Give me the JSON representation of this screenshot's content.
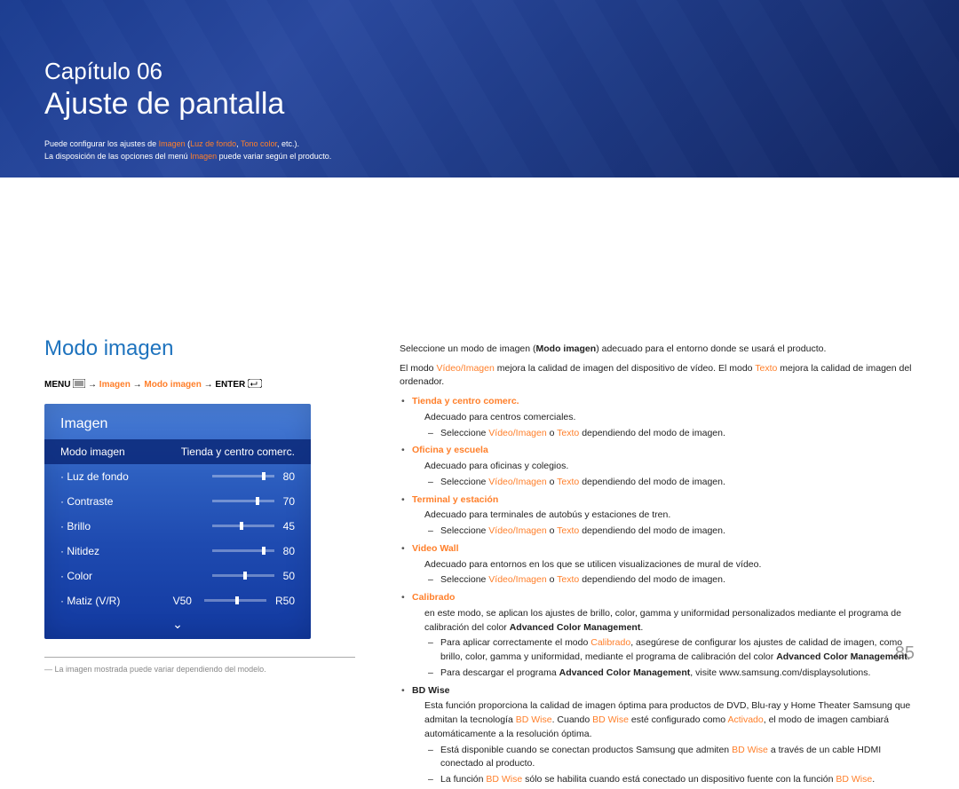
{
  "chapter": "Capítulo 06",
  "title": "Ajuste de pantalla",
  "intro": {
    "line1_pre": "Puede configurar los ajustes de ",
    "line1_a1": "Imagen",
    "line1_mid1": " (",
    "line1_a2": "Luz de fondo",
    "line1_mid2": ", ",
    "line1_a3": "Tono color",
    "line1_post": ", etc.).",
    "line2_pre": "La disposición de las opciones del menú ",
    "line2_a": "Imagen",
    "line2_post": " puede variar según el producto."
  },
  "section_title": "Modo imagen",
  "menu_path": {
    "menu": "MENU",
    "arrow": " → ",
    "p1": "Imagen",
    "p2": "Modo imagen",
    "enter": "ENTER"
  },
  "osd": {
    "title": "Imagen",
    "hl_label": "Modo imagen",
    "hl_value": "Tienda y centro comerc.",
    "rows": [
      {
        "label": "Luz de fondo",
        "value": "80",
        "pct": 80
      },
      {
        "label": "Contraste",
        "value": "70",
        "pct": 70
      },
      {
        "label": "Brillo",
        "value": "45",
        "pct": 45
      },
      {
        "label": "Nitidez",
        "value": "80",
        "pct": 80
      },
      {
        "label": "Color",
        "value": "50",
        "pct": 50
      }
    ],
    "matiz_label": "Matiz (V/R)",
    "matiz_left": "V50",
    "matiz_right": "R50",
    "down": "⌄"
  },
  "footnote": "La imagen mostrada puede variar dependiendo del modelo.",
  "right": {
    "p1_pre": "Seleccione un modo de imagen (",
    "p1_b": "Modo imagen",
    "p1_post": ") adecuado para el entorno donde se usará el producto.",
    "p2_pre": "El modo ",
    "p2_a1": "Vídeo/Imagen",
    "p2_mid": " mejora la calidad de imagen del dispositivo de vídeo. El modo ",
    "p2_a2": "Texto",
    "p2_post": " mejora la calidad de imagen del ordenador.",
    "items": [
      {
        "title": "Tienda y centro comerc.",
        "desc": "Adecuado para centros comerciales.",
        "sub_pre": "Seleccione ",
        "sub_a1": "Vídeo/Imagen",
        "sub_mid": " o ",
        "sub_a2": "Texto",
        "sub_post": " dependiendo del modo de imagen."
      },
      {
        "title": "Oficina y escuela",
        "desc": "Adecuado para oficinas y colegios.",
        "sub_pre": "Seleccione ",
        "sub_a1": "Vídeo/Imagen",
        "sub_mid": " o ",
        "sub_a2": "Texto",
        "sub_post": " dependiendo del modo de imagen."
      },
      {
        "title": "Terminal y estación",
        "desc": "Adecuado para terminales de autobús y estaciones de tren.",
        "sub_pre": "Seleccione ",
        "sub_a1": "Vídeo/Imagen",
        "sub_mid": " o ",
        "sub_a2": "Texto",
        "sub_post": " dependiendo del modo de imagen."
      },
      {
        "title": "Video Wall",
        "desc": "Adecuado para entornos en los que se utilicen visualizaciones de mural de vídeo.",
        "sub_pre": "Seleccione ",
        "sub_a1": "Vídeo/Imagen",
        "sub_mid": " o ",
        "sub_a2": "Texto",
        "sub_post": " dependiendo del modo de imagen."
      }
    ],
    "calibrado": {
      "title": "Calibrado",
      "desc_pre": "en este modo, se aplican los ajustes de brillo, color, gamma y uniformidad personalizados mediante el programa de calibración del color ",
      "desc_b": "Advanced Color Management",
      "desc_post": ".",
      "d1_pre": "Para aplicar correctamente el modo ",
      "d1_a": "Calibrado",
      "d1_mid": ", asegúrese de configurar los ajustes de calidad de imagen, como brillo, color, gamma y uniformidad, mediante el programa de calibración del color ",
      "d1_b": "Advanced Color Management",
      "d1_post": ".",
      "d2_pre": "Para descargar el programa ",
      "d2_b": "Advanced Color Management",
      "d2_post": ", visite www.samsung.com/displaysolutions."
    },
    "bdwise": {
      "title": "BD Wise",
      "desc_pre": "Esta función proporciona la calidad de imagen óptima para productos de DVD, Blu-ray y Home Theater Samsung que admitan la tecnología ",
      "desc_a1": "BD Wise",
      "desc_mid1": ". Cuando ",
      "desc_a2": "BD Wise",
      "desc_mid2": " esté configurado como ",
      "desc_a3": "Activado",
      "desc_post": ", el modo de imagen cambiará automáticamente a la resolución óptima.",
      "d1_pre": "Está disponible cuando se conectan productos Samsung que admiten ",
      "d1_a": "BD Wise",
      "d1_post": " a través de un cable HDMI conectado al producto.",
      "d2_pre": "La función ",
      "d2_a1": "BD Wise",
      "d2_mid": " sólo se habilita cuando está conectado un dispositivo fuente con la función ",
      "d2_a2": "BD Wise",
      "d2_post": "."
    }
  },
  "page_num": "85"
}
